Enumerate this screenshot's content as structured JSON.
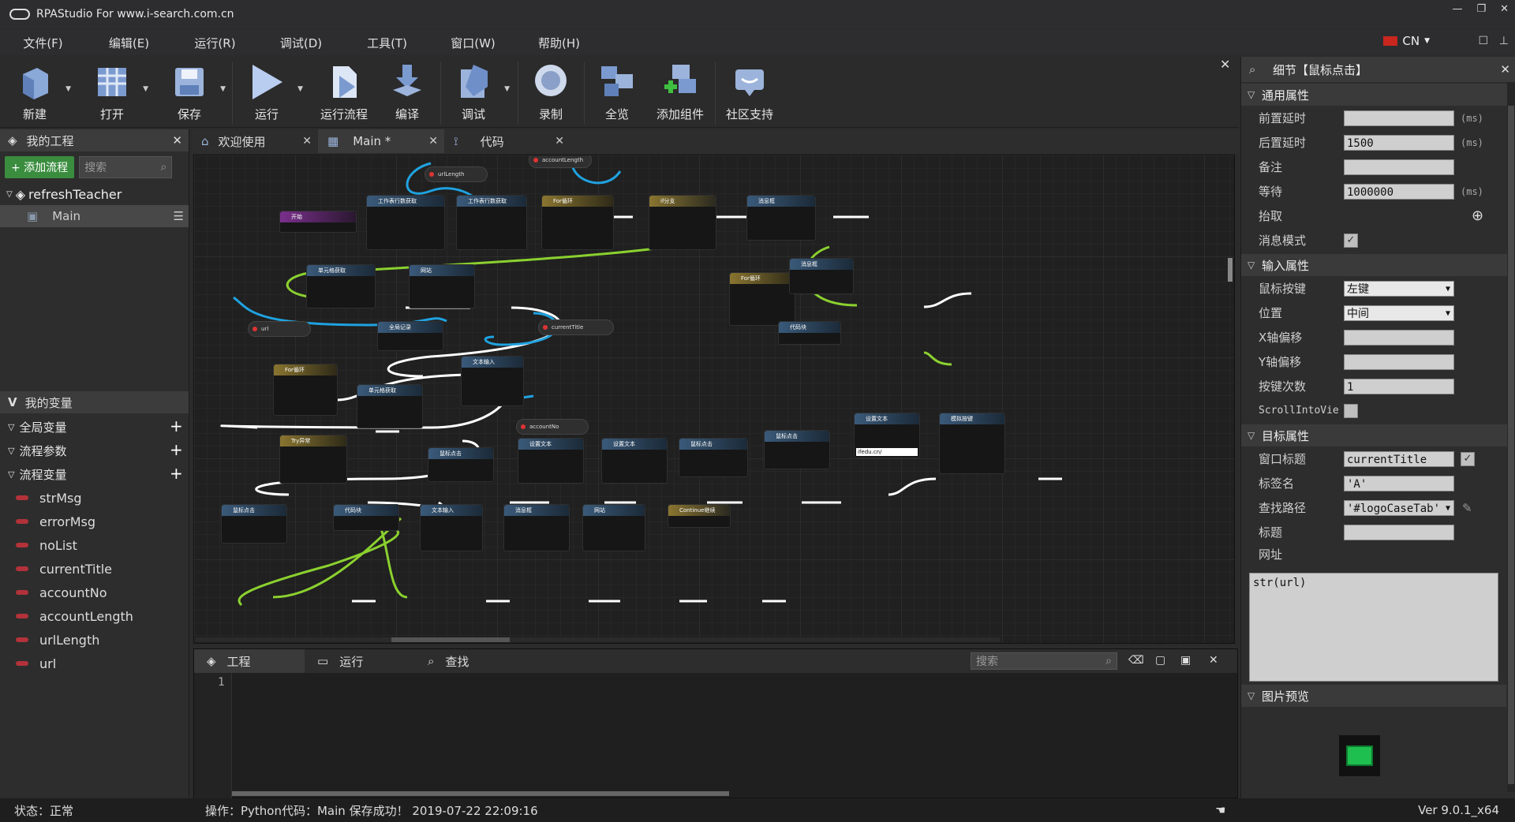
{
  "window": {
    "title": "RPAStudio For www.i-search.com.cn"
  },
  "menu": [
    "文件(F)",
    "编辑(E)",
    "运行(R)",
    "调试(D)",
    "工具(T)",
    "窗口(W)",
    "帮助(H)"
  ],
  "lang": "CN",
  "toolbar": [
    {
      "label": "新建",
      "icon": "new-project-icon"
    },
    {
      "label": "打开",
      "icon": "open-icon"
    },
    {
      "label": "保存",
      "icon": "save-icon"
    },
    {
      "label": "运行",
      "icon": "run-icon"
    },
    {
      "label": "运行流程",
      "icon": "run-flow-icon"
    },
    {
      "label": "编译",
      "icon": "compile-icon"
    },
    {
      "label": "调试",
      "icon": "debug-icon"
    },
    {
      "label": "录制",
      "icon": "record-icon"
    },
    {
      "label": "全览",
      "icon": "overview-icon"
    },
    {
      "label": "添加组件",
      "icon": "add-component-icon"
    },
    {
      "label": "社区支持",
      "icon": "community-icon"
    }
  ],
  "project": {
    "header": "我的工程",
    "add_button": "+ 添加流程",
    "search_placeholder": "搜索",
    "root": "refreshTeacher",
    "child": "Main"
  },
  "variables": {
    "header": "我的变量",
    "sections": [
      "全局变量",
      "流程参数",
      "流程变量"
    ],
    "items": [
      "strMsg",
      "errorMsg",
      "noList",
      "currentTitle",
      "accountNo",
      "accountLength",
      "urlLength",
      "url"
    ]
  },
  "tabs": [
    {
      "label": "欢迎使用"
    },
    {
      "label": "Main *"
    },
    {
      "label": "代码"
    }
  ],
  "canvas": {
    "nodes": [
      "开始",
      "工作表行数获取",
      "工作表行数获取",
      "For循环",
      "if分支",
      "消息框",
      "单元格获取",
      "网站",
      "全局记录",
      "For循环",
      "文本输入",
      "单元格获取",
      "Try异常",
      "鼠标点击",
      "设置文本",
      "设置文本",
      "鼠标点击",
      "鼠标点击",
      "设置文本",
      "模拟按键",
      "鼠标点击",
      "代码块",
      "文本输入",
      "消息框",
      "网站",
      "Continue继续",
      "For循环",
      "消息框",
      "代码块"
    ],
    "variables": [
      "urlLength",
      "accountLength",
      "url",
      "currentTitle",
      "accountNo"
    ],
    "text_field": "ifedu.cn/"
  },
  "bottom": {
    "tabs": [
      "工程",
      "运行",
      "查找"
    ],
    "search_placeholder": "搜索",
    "line_number": "1"
  },
  "details": {
    "header": "细节【鼠标点击】",
    "sections": {
      "common": "通用属性",
      "input": "输入属性",
      "target": "目标属性",
      "preview": "图片预览"
    },
    "common": [
      {
        "label": "前置延时",
        "value": "",
        "unit": "(ms)"
      },
      {
        "label": "后置延时",
        "value": "1500",
        "unit": "(ms)"
      },
      {
        "label": "备注",
        "value": "",
        "unit": ""
      },
      {
        "label": "等待",
        "value": "1000000",
        "unit": "(ms)"
      },
      {
        "label": "抬取",
        "value": "",
        "unit": ""
      },
      {
        "label": "消息模式",
        "value": "",
        "unit": ""
      }
    ],
    "input": [
      {
        "label": "鼠标按键",
        "value": "左键"
      },
      {
        "label": "位置",
        "value": "中间"
      },
      {
        "label": "X轴偏移",
        "value": ""
      },
      {
        "label": "Y轴偏移",
        "value": ""
      },
      {
        "label": "按键次数",
        "value": "1"
      },
      {
        "label": "ScrollIntoVie",
        "value": ""
      }
    ],
    "target": [
      {
        "label": "窗口标题",
        "value": "currentTitle"
      },
      {
        "label": "标签名",
        "value": "'A'"
      },
      {
        "label": "查找路径",
        "value": "'#logoCaseTab'"
      },
      {
        "label": "标题",
        "value": ""
      },
      {
        "label": "网址",
        "value": ""
      }
    ],
    "url_value": "str(url)"
  },
  "status": {
    "state": "状态：正常",
    "message": "操作：Python代码：Main 保存成功！ 2019-07-22 22:09:16",
    "version": "Ver 9.0.1_x64"
  }
}
